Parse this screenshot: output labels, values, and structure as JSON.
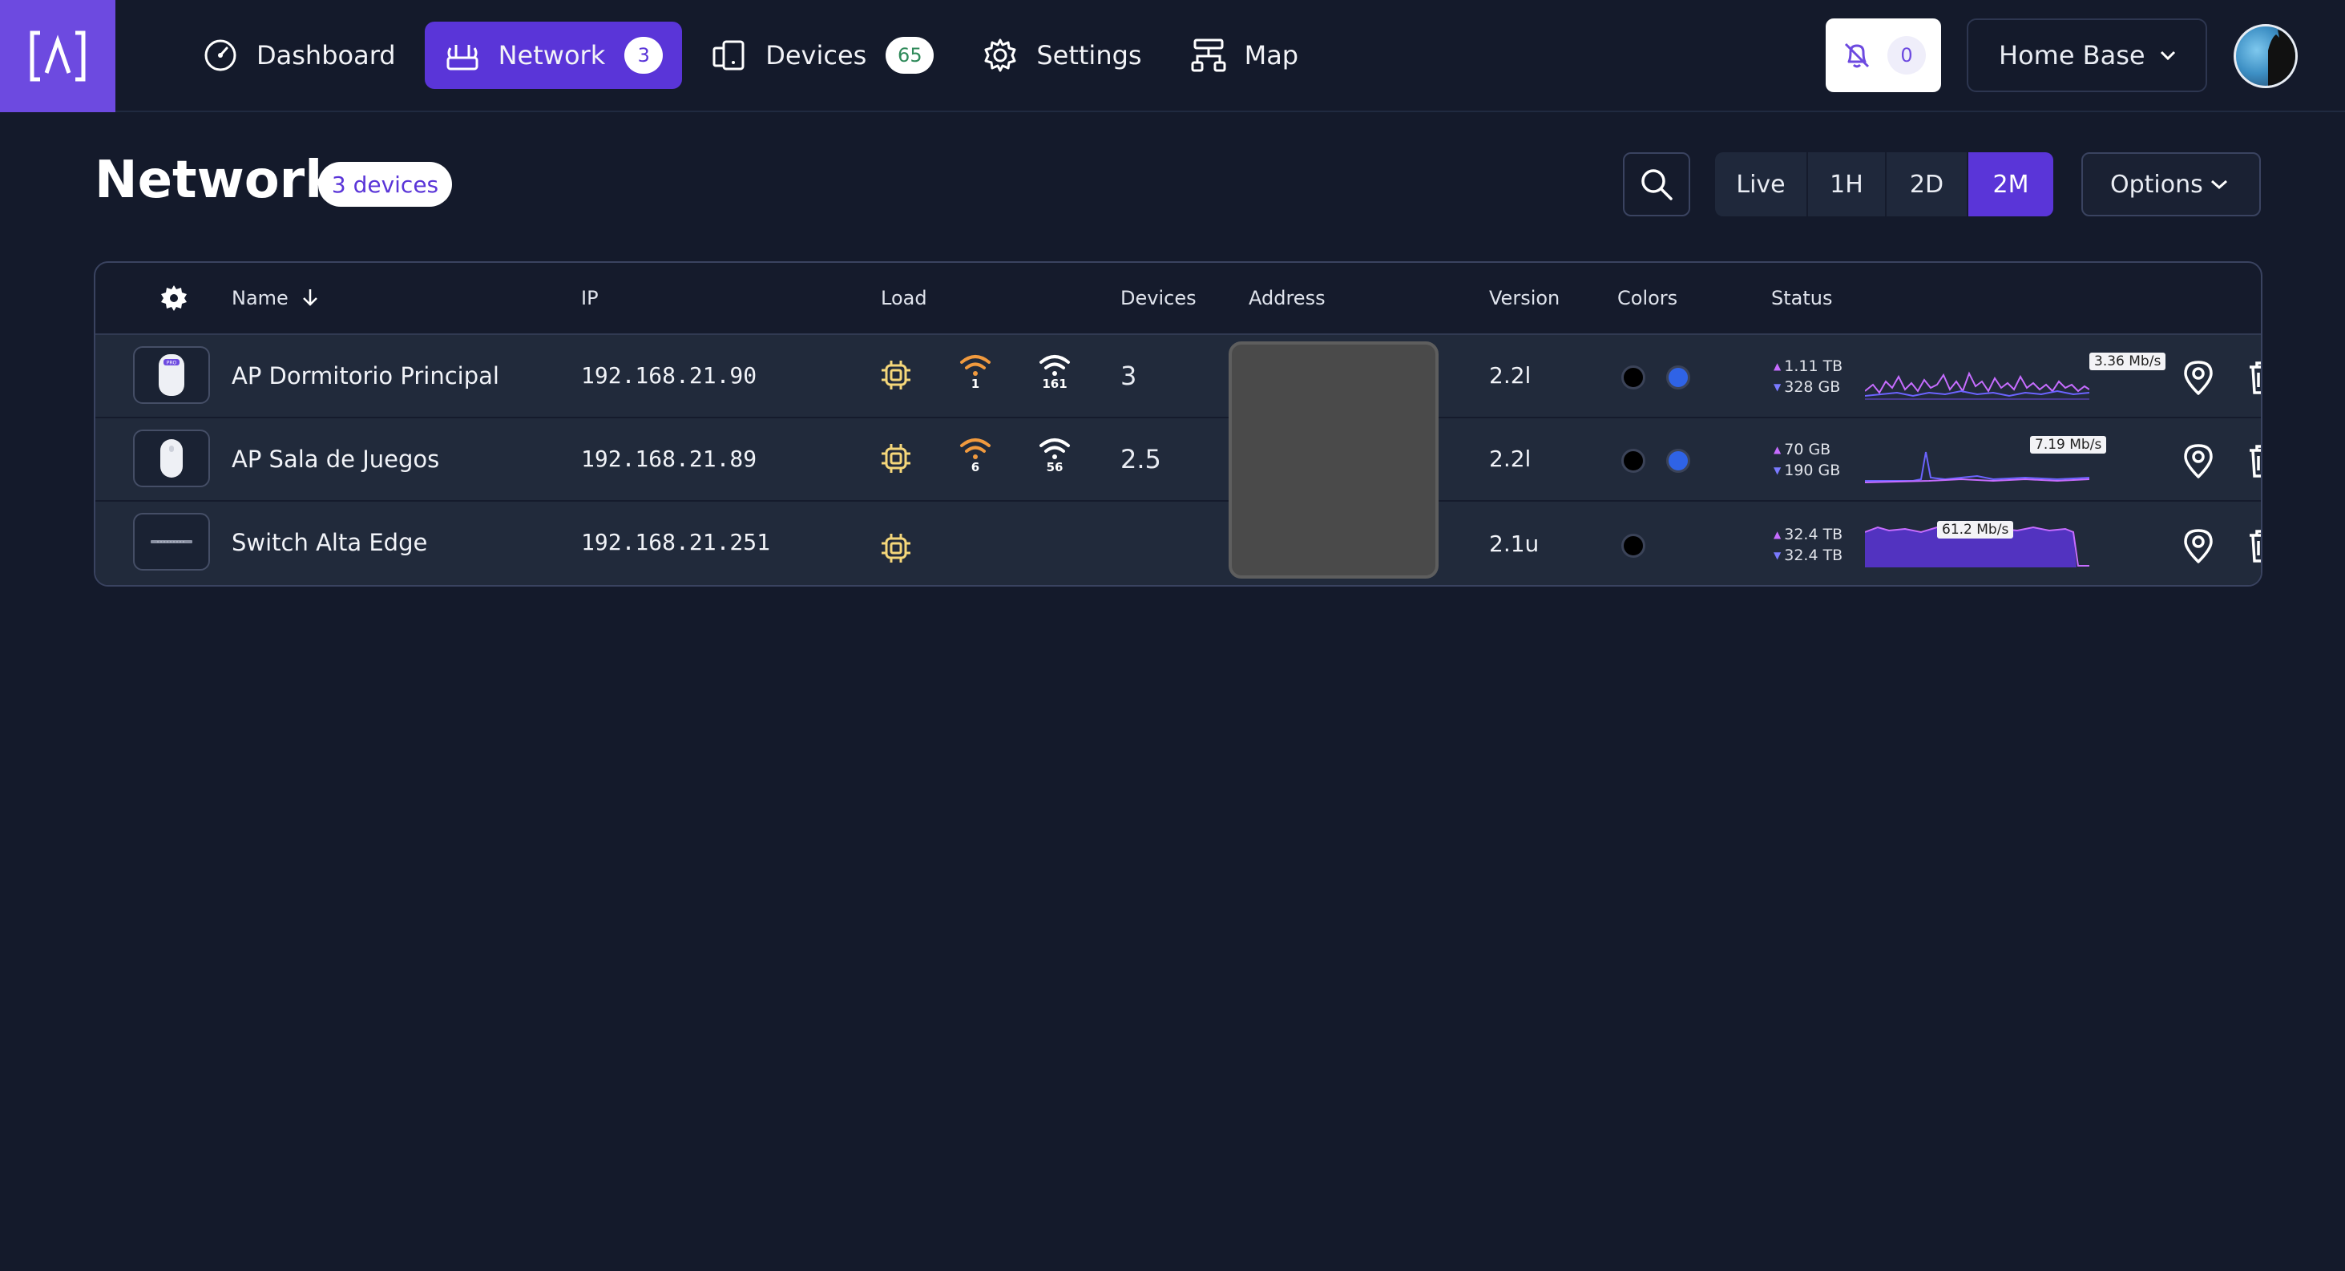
{
  "nav": {
    "items": [
      {
        "label": "Dashboard",
        "icon": "speedometer-icon",
        "active": false
      },
      {
        "label": "Network",
        "icon": "router-icon",
        "active": true,
        "badge": "3"
      },
      {
        "label": "Devices",
        "icon": "devices-icon",
        "active": false,
        "badge": "65"
      },
      {
        "label": "Settings",
        "icon": "gear-icon",
        "active": false
      },
      {
        "label": "Map",
        "icon": "topology-icon",
        "active": false
      }
    ]
  },
  "header": {
    "notifications_count": "0",
    "site": "Home Base"
  },
  "page": {
    "title": "Network",
    "device_count": "3 devices"
  },
  "time_range": {
    "options": [
      "Live",
      "1H",
      "2D",
      "2M"
    ],
    "selected": "2M"
  },
  "options_label": "Options",
  "table": {
    "columns": {
      "name": "Name",
      "ip": "IP",
      "load": "Load",
      "devices": "Devices",
      "address": "Address",
      "version": "Version",
      "colors": "Colors",
      "status": "Status"
    },
    "sort": {
      "column": "Name",
      "direction": "descending"
    },
    "rows": [
      {
        "name": "AP Dormitorio Principal",
        "ip": "192.168.21.90",
        "wifi_2g": "1",
        "wifi_5g": "161",
        "devices": "3",
        "version": "2.2l",
        "colors": [
          "#000000",
          "#2f63e6"
        ],
        "upload": "1.11 TB",
        "download": "328 GB",
        "rate": "3.36 Mb/s",
        "thumb": "pro-access-point"
      },
      {
        "name": "AP Sala de Juegos",
        "ip": "192.168.21.89",
        "wifi_2g": "6",
        "wifi_5g": "56",
        "devices": "2.5",
        "version": "2.2l",
        "colors": [
          "#000000",
          "#2f63e6"
        ],
        "upload": "70 GB",
        "download": "190 GB",
        "rate": "7.19 Mb/s",
        "thumb": "access-point"
      },
      {
        "name": "Switch Alta Edge",
        "ip": "192.168.21.251",
        "wifi_2g": "",
        "wifi_5g": "",
        "devices": "",
        "version": "2.1u",
        "colors": [
          "#000000"
        ],
        "upload": "32.4 TB",
        "download": "32.4 TB",
        "rate": "61.2 Mb/s",
        "thumb": "switch"
      }
    ]
  },
  "colors": {
    "accent": "#5a35d8",
    "background": "#141a2b",
    "row": "#212a3b",
    "load_icon": "#f5d77a",
    "wifi_2g": "#f19a3e",
    "upload_series": "#c66cff",
    "download_series": "#6b63ff"
  }
}
